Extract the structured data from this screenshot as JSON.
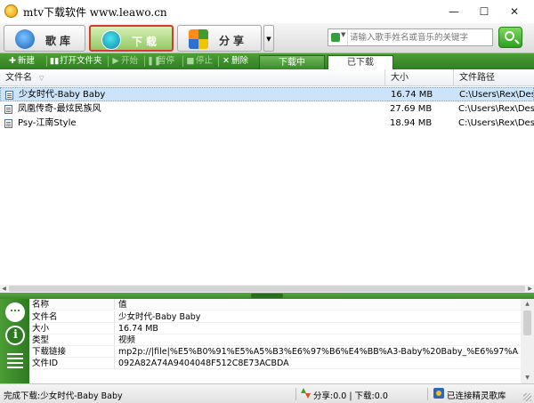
{
  "window": {
    "title": "mtv下载软件 www.leawo.cn",
    "minimize_glyph": "—",
    "maximize_glyph": "☐",
    "close_glyph": "✕"
  },
  "tabs": [
    {
      "label": "歌库",
      "icon": "music-library-icon"
    },
    {
      "label": "下载",
      "icon": "download-icon",
      "active": true
    },
    {
      "label": "分享",
      "icon": "share-icon"
    }
  ],
  "tab_dropdown_glyph": "▼",
  "search": {
    "placeholder": "请输入歌手姓名或音乐的关键字",
    "type_arrow": "▼"
  },
  "actions": [
    {
      "glyph": "✚",
      "label": "新建",
      "enabled": true
    },
    {
      "glyph": "▮▮",
      "label": "打开文件夹",
      "enabled": true
    },
    {
      "glyph": "▶",
      "label": "开始",
      "enabled": false
    },
    {
      "glyph": "❚❚",
      "label": "暂停",
      "enabled": false
    },
    {
      "glyph": "■",
      "label": "停止",
      "enabled": false
    },
    {
      "glyph": "✕",
      "label": "删除",
      "enabled": true
    }
  ],
  "subtabs": {
    "downloading": "下载中",
    "downloaded": "已下载"
  },
  "table": {
    "columns": {
      "name": "文件名",
      "size": "大小",
      "path": "文件路径"
    },
    "sort_glyph": "▽",
    "rows": [
      {
        "name": "少女时代-Baby Baby",
        "size": "16.74 MB",
        "path": "C:\\Users\\Rex\\Desktop",
        "selected": true
      },
      {
        "name": "凤凰传奇-最炫民族风",
        "size": "27.69 MB",
        "path": "C:\\Users\\Rex\\Desktop"
      },
      {
        "name": "Psy-江南Style",
        "size": "18.94 MB",
        "path": "C:\\Users\\Rex\\Desktop"
      }
    ]
  },
  "details": {
    "header": {
      "key": "名称",
      "value": "值"
    },
    "rows": [
      {
        "key": "文件名",
        "value": "少女时代-Baby Baby"
      },
      {
        "key": "大小",
        "value": "16.74 MB"
      },
      {
        "key": "类型",
        "value": "视频"
      },
      {
        "key": "下载链接",
        "value": "mp2p://|file|%E5%B0%91%E5%A5%B3%E6%97%B6%E4%BB%A3-Baby%20Baby_%E6%97%A5%E9%9F%A9_%E7..."
      },
      {
        "key": "文件ID",
        "value": "092A82A74A9404048F512C8E73ACBDA"
      }
    ]
  },
  "status": {
    "left": "完成下载:少女时代-Baby Baby",
    "traffic": "分享:0.0 | 下载:0.0",
    "connection": "已连接精灵歌库"
  },
  "scroll_glyphs": {
    "left": "◀",
    "right": "▶",
    "up": "▲",
    "down": "▼"
  }
}
